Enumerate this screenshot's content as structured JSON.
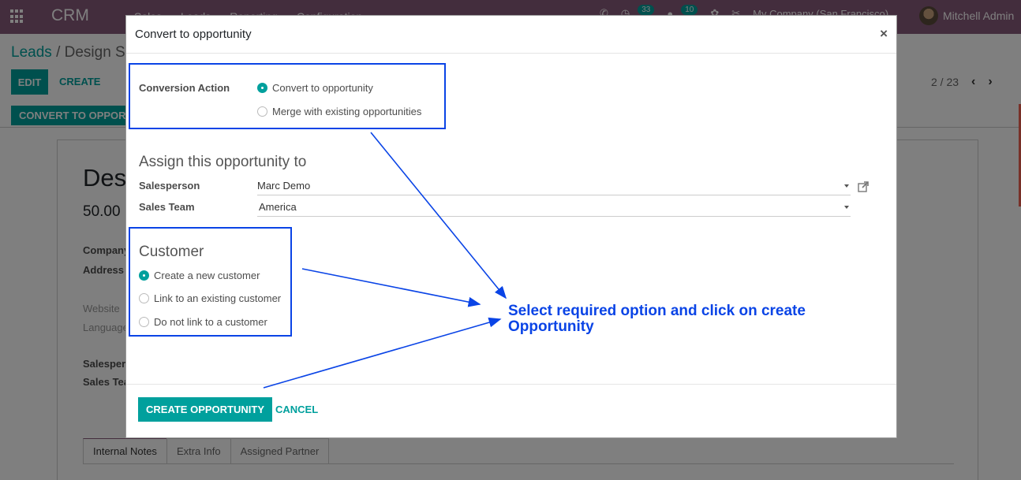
{
  "navbar": {
    "app_name": "CRM",
    "menu": [
      "Sales",
      "Leads",
      "Reporting",
      "Configuration"
    ],
    "activity_count": "33",
    "message_count": "10",
    "company": "My Company (San Francisco)",
    "user": "Mitchell Admin"
  },
  "control_panel": {
    "breadcrumb_parent": "Leads",
    "breadcrumb_separator": "/",
    "breadcrumb_current": "Design Software",
    "edit_label": "EDIT",
    "create_label": "CREATE",
    "pager": "2 / 23",
    "prev_icon": "‹",
    "next_icon": "›"
  },
  "statusbar": {
    "convert_label": "CONVERT TO OPPORTUNITY"
  },
  "sheet": {
    "title": "Design Software",
    "expected_revenue": "50.00",
    "fields": [
      "Company",
      "Address",
      "Website",
      "Language",
      "Salesperson",
      "Sales Team"
    ],
    "tabs": [
      "Internal Notes",
      "Extra Info",
      "Assigned Partner"
    ]
  },
  "modal": {
    "title": "Convert to opportunity",
    "close_icon": "×",
    "conversion_action": {
      "label": "Conversion Action",
      "options": [
        {
          "label": "Convert to opportunity",
          "checked": true
        },
        {
          "label": "Merge with existing opportunities",
          "checked": false
        }
      ]
    },
    "assign_section_title": "Assign this opportunity to",
    "salesperson": {
      "label": "Salesperson",
      "value": "Marc Demo"
    },
    "sales_team": {
      "label": "Sales Team",
      "value": "America"
    },
    "customer": {
      "title": "Customer",
      "options": [
        {
          "label": "Create a new customer",
          "checked": true
        },
        {
          "label": "Link to an existing customer",
          "checked": false
        },
        {
          "label": "Do not link to a customer",
          "checked": false
        }
      ]
    },
    "primary_button": "CREATE OPPORTUNITY",
    "cancel_button": "CANCEL"
  },
  "annotation": {
    "text": "Select required option and click on create Opportunity",
    "color": "#0a44e6"
  },
  "colors": {
    "brand": "#875a7b",
    "accent": "#00a09d"
  }
}
